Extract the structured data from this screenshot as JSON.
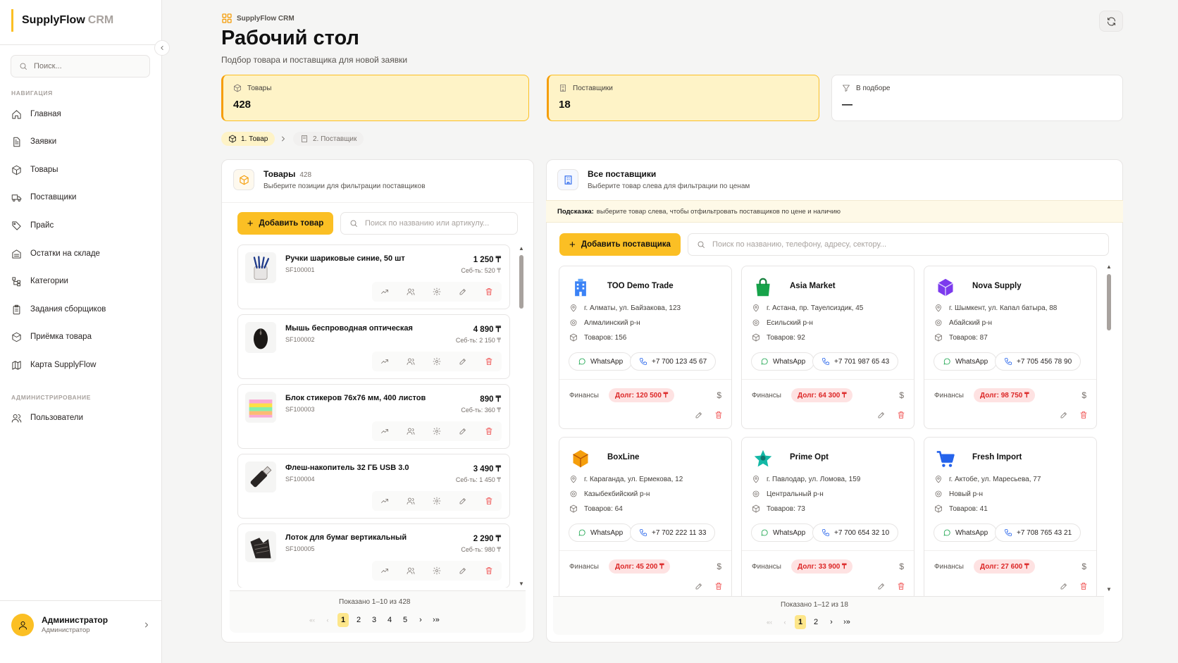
{
  "app": {
    "name": "SupplyFlow",
    "suffix": "CRM"
  },
  "sidebar": {
    "search_placeholder": "Поиск...",
    "nav_section": "Навигация",
    "admin_section": "Администрирование",
    "items": [
      {
        "label": "Главная",
        "icon": "home-icon"
      },
      {
        "label": "Заявки",
        "icon": "document-icon"
      },
      {
        "label": "Товары",
        "icon": "package-icon"
      },
      {
        "label": "Поставщики",
        "icon": "truck-icon"
      },
      {
        "label": "Прайс",
        "icon": "tag-icon"
      },
      {
        "label": "Остатки на складе",
        "icon": "warehouse-icon"
      },
      {
        "label": "Категории",
        "icon": "tree-icon"
      },
      {
        "label": "Задания сборщиков",
        "icon": "clipboard-icon"
      },
      {
        "label": "Приёмка товара",
        "icon": "box-receive-icon"
      },
      {
        "label": "Карта SupplyFlow",
        "icon": "map-icon"
      }
    ],
    "admin_items": [
      {
        "label": "Пользователи",
        "icon": "users-icon"
      }
    ],
    "user": {
      "name": "Администратор",
      "role": "Администратор"
    }
  },
  "header": {
    "breadcrumb": "SupplyFlow CRM",
    "title": "Рабочий стол",
    "subtitle": "Подбор товара и поставщика для новой заявки"
  },
  "stats": [
    {
      "label": "Товары",
      "value": "428"
    },
    {
      "label": "Поставщики",
      "value": "18"
    },
    {
      "label": "В подборе",
      "value": "—"
    }
  ],
  "steps": [
    {
      "label": "1. Товар"
    },
    {
      "label": "2. Поставщик"
    }
  ],
  "products_panel": {
    "title": "Товары",
    "count": "428",
    "subtitle": "Выберите позиции для фильтрации поставщиков",
    "add_label": "Добавить товар",
    "search_placeholder": "Поиск по названию или артикулу...",
    "items": [
      {
        "name": "Ручки шариковые синие, 50 шт",
        "sku": "SF100001",
        "price": "1 250 ₸",
        "cost": "Себ-ть: 520 ₸",
        "image": "pens-icon"
      },
      {
        "name": "Мышь беспроводная оптическая",
        "sku": "SF100002",
        "price": "4 890 ₸",
        "cost": "Себ-ть: 2 150 ₸",
        "image": "mouse-icon"
      },
      {
        "name": "Блок стикеров 76x76 мм, 400 листов",
        "sku": "SF100003",
        "price": "890 ₸",
        "cost": "Себ-ть: 360 ₸",
        "image": "stickers-icon"
      },
      {
        "name": "Флеш-накопитель 32 ГБ USB 3.0",
        "sku": "SF100004",
        "price": "3 490 ₸",
        "cost": "Себ-ть: 1 450 ₸",
        "image": "usb-icon"
      },
      {
        "name": "Лоток для бумаг вертикальный",
        "sku": "SF100005",
        "price": "2 290 ₸",
        "cost": "Себ-ть: 980 ₸",
        "image": "tray-icon"
      }
    ],
    "pagination": {
      "info": "Показано 1–10 из 428",
      "first": "«‹",
      "prev": "‹",
      "pages": [
        "1",
        "2",
        "3",
        "4",
        "5"
      ],
      "next": "›",
      "last": "›»"
    }
  },
  "suppliers_panel": {
    "title": "Все поставщики",
    "subtitle": "Выберите товар слева для фильтрации по ценам",
    "hint_label": "Подсказка:",
    "hint_text": "выберите товар слева, чтобы отфильтровать поставщиков по цене и наличию",
    "add_label": "Добавить поставщика",
    "search_placeholder": "Поиск по названию, телефону, адресу, сектору...",
    "finance_label": "Финансы",
    "whatsapp_label": "WhatsApp",
    "currency_symbol": "$",
    "items": [
      {
        "name": "ТОО Demo Trade",
        "address": "г. Алматы, ул. Байзакова, 123",
        "district": "Алмалинский р-н",
        "goods": "Товаров: 156",
        "phone": "+7 700 123 45 67",
        "debt": "Долг: 120 500 ₸",
        "logo": "building-logo",
        "logo_color": "#3b82f6"
      },
      {
        "name": "Asia Market",
        "address": "г. Астана, пр. Тауелсиздик, 45",
        "district": "Есильский р-н",
        "goods": "Товаров: 92",
        "phone": "+7 701 987 65 43",
        "debt": "Долг: 64 300 ₸",
        "logo": "shopping-bag-logo",
        "logo_color": "#16a34a"
      },
      {
        "name": "Nova Supply",
        "address": "г. Шымкент, ул. Капал батыра, 88",
        "district": "Абайский р-н",
        "goods": "Товаров: 87",
        "phone": "+7 705 456 78 90",
        "debt": "Долг: 98 750 ₸",
        "logo": "cube-logo",
        "logo_color": "#7c3aed"
      },
      {
        "name": "BoxLine",
        "address": "г. Караганда, ул. Ермекова, 12",
        "district": "Казыбекбийский р-н",
        "goods": "Товаров: 64",
        "phone": "+7 702 222 11 33",
        "debt": "Долг: 45 200 ₸",
        "logo": "box-logo",
        "logo_color": "#f59e0b"
      },
      {
        "name": "Prime Opt",
        "address": "г. Павлодар, ул. Ломова, 159",
        "district": "Центральный р-н",
        "goods": "Товаров: 73",
        "phone": "+7 700 654 32 10",
        "debt": "Долг: 33 900 ₸",
        "logo": "star-logo",
        "logo_color": "#14b8a6"
      },
      {
        "name": "Fresh Import",
        "address": "г. Актобе, ул. Маресьева, 77",
        "district": "Новый р-н",
        "goods": "Товаров: 41",
        "phone": "+7 708 765 43 21",
        "debt": "Долг: 27 600 ₸",
        "logo": "cart-logo",
        "logo_color": "#2563eb"
      }
    ],
    "pagination": {
      "info": "Показано 1–12 из 18",
      "first": "«‹",
      "prev": "‹",
      "pages": [
        "1",
        "2"
      ],
      "next": "›",
      "last": "›»"
    }
  },
  "colors": {
    "accent": "#fbbf24",
    "accent_bg": "#fef3c7",
    "debt_bg": "#fee2e2",
    "debt_text": "#dc2626",
    "delete": "#ef4444"
  }
}
